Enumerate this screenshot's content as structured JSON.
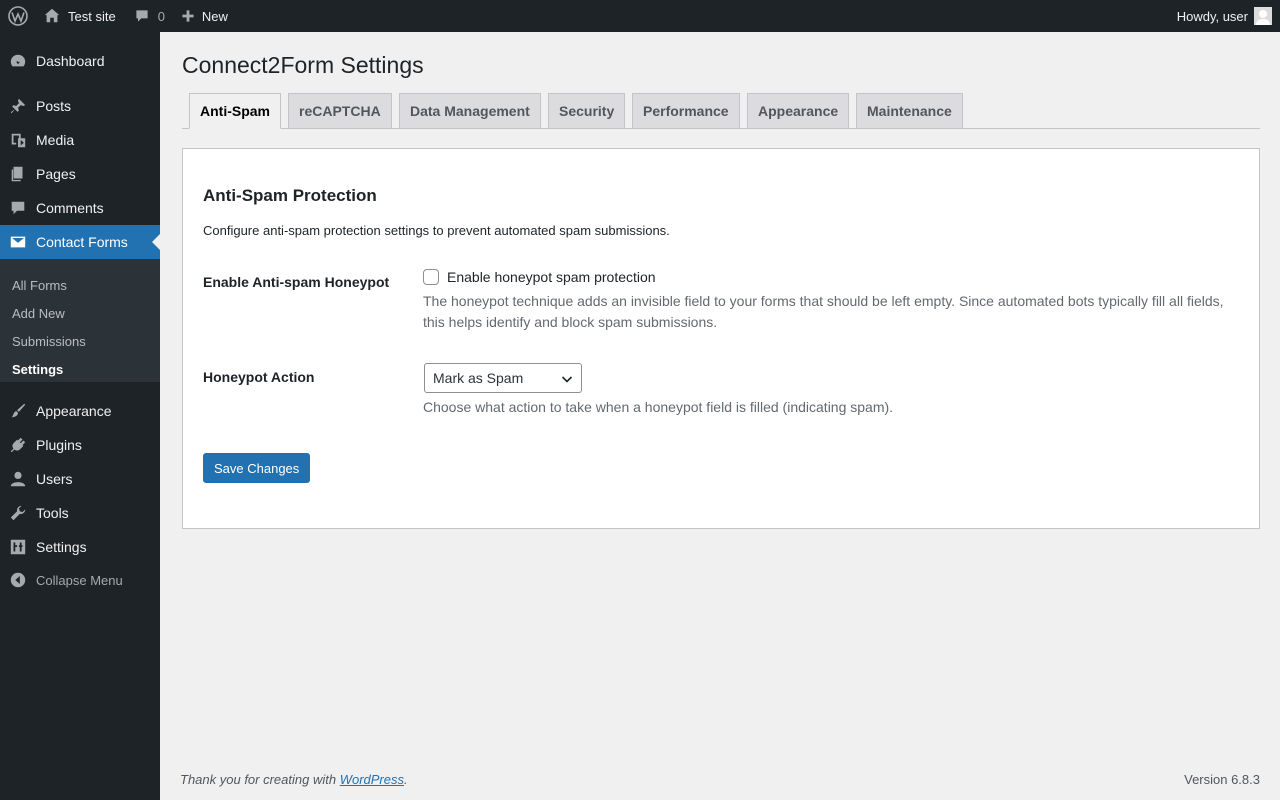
{
  "adminbar": {
    "site_name": "Test site",
    "comments_count": "0",
    "new_label": "New",
    "howdy": "Howdy, user"
  },
  "sidebar": {
    "items": [
      {
        "label": "Dashboard",
        "icon": "dashboard-icon"
      },
      {
        "label": "Posts",
        "icon": "pin-icon"
      },
      {
        "label": "Media",
        "icon": "media-icon"
      },
      {
        "label": "Pages",
        "icon": "pages-icon"
      },
      {
        "label": "Comments",
        "icon": "comment-icon"
      },
      {
        "label": "Contact Forms",
        "icon": "envelope-icon"
      },
      {
        "label": "Appearance",
        "icon": "brush-icon"
      },
      {
        "label": "Plugins",
        "icon": "plugin-icon"
      },
      {
        "label": "Users",
        "icon": "user-icon"
      },
      {
        "label": "Tools",
        "icon": "wrench-icon"
      },
      {
        "label": "Settings",
        "icon": "settings-icon"
      }
    ],
    "submenu": [
      "All Forms",
      "Add New",
      "Submissions",
      "Settings"
    ],
    "collapse_label": "Collapse Menu"
  },
  "page": {
    "title": "Connect2Form Settings",
    "tabs": [
      "Anti-Spam",
      "reCAPTCHA",
      "Data Management",
      "Security",
      "Performance",
      "Appearance",
      "Maintenance"
    ],
    "active_tab": "Anti-Spam"
  },
  "section": {
    "title": "Anti-Spam Protection",
    "description": "Configure anti-spam protection settings to prevent automated spam submissions.",
    "honeypot_label": "Enable Anti-spam Honeypot",
    "honeypot_checkbox_label": "Enable honeypot spam protection",
    "honeypot_checked": false,
    "honeypot_help_line1": "The honeypot technique adds an invisible field to your forms that should be left empty. Since automated bots typically fill all fields,",
    "honeypot_help_line2": "this helps identify and block spam submissions.",
    "action_label": "Honeypot Action",
    "action_value": "Mark as Spam",
    "action_help": "Choose what action to take when a honeypot field is filled (indicating spam).",
    "save_label": "Save Changes"
  },
  "footer": {
    "thanks_prefix": "Thank you for creating with ",
    "thanks_link": "WordPress",
    "thanks_suffix": ".",
    "version": "Version 6.8.3"
  },
  "colors": {
    "accent": "#2271b1",
    "sidebar_bg": "#1d2327",
    "submenu_bg": "#2c3338",
    "page_bg": "#f0f0f1"
  }
}
